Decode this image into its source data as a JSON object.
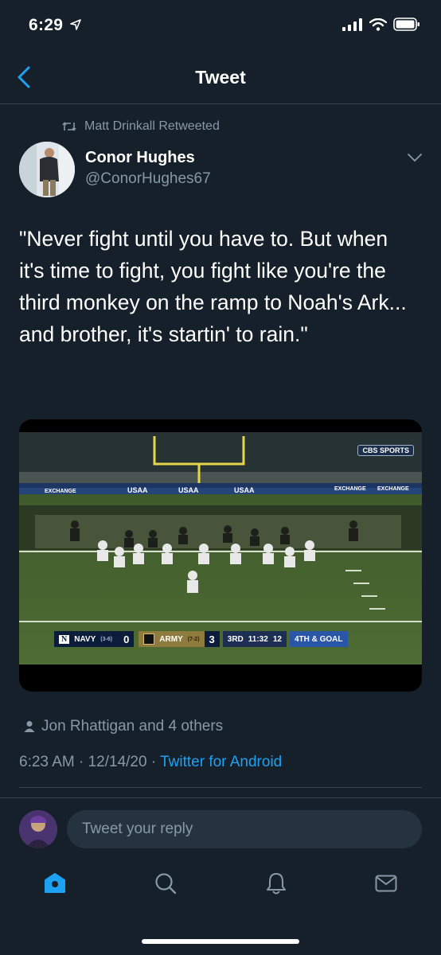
{
  "status_bar": {
    "time": "6:29"
  },
  "header": {
    "title": "Tweet"
  },
  "tweet": {
    "retweeted_by": "Matt Drinkall Retweeted",
    "author_name": "Conor Hughes",
    "author_handle": "@ConorHughes67",
    "text": "\"Never fight until you have to. But when it's time to fight, you fight like you're the third monkey on the ramp to Noah's Ark... and brother, it's startin' to rain.\"",
    "liked_by": "Jon Rhattigan and 4 others",
    "timestamp": "6:23 AM · 12/14/20 · ",
    "source": "Twitter for Android"
  },
  "video": {
    "network": "CBS SPORTS",
    "sponsor": "USAA",
    "exchange": "EXCHANGE",
    "scoreboard": {
      "away_team": "NAVY",
      "away_record": "(3-6)",
      "away_score": "0",
      "home_team": "ARMY",
      "home_record": "(7-2)",
      "home_score": "3",
      "quarter": "3RD",
      "clock": "11:32",
      "play_clock": "12",
      "down": "4TH & GOAL"
    }
  },
  "reply": {
    "placeholder": "Tweet your reply"
  },
  "nav": {
    "items": [
      "home-icon",
      "search-icon",
      "notifications-icon",
      "messages-icon"
    ],
    "active_color": "#1da1f2"
  },
  "colors": {
    "background": "#15202b",
    "muted": "#8899a6",
    "accent": "#1da1f2",
    "divider": "#38444d"
  }
}
